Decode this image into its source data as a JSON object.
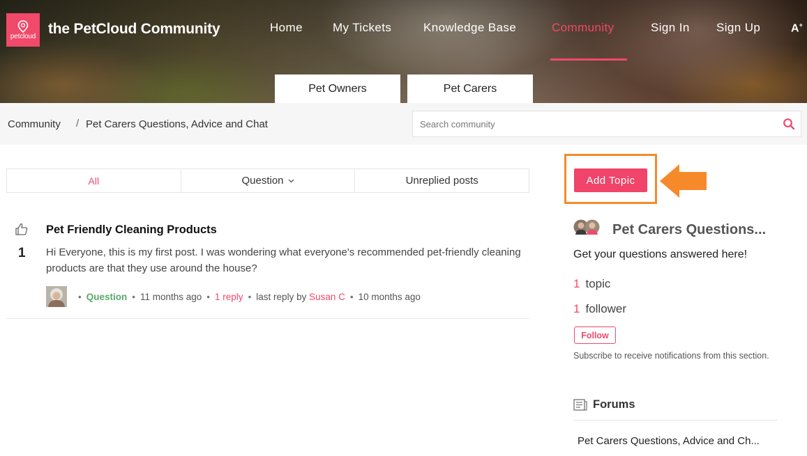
{
  "header": {
    "logo_text": "petcloud",
    "site_title": "the PetCloud Community",
    "nav": [
      {
        "label": "Home"
      },
      {
        "label": "My Tickets"
      },
      {
        "label": "Knowledge Base"
      },
      {
        "label": "Community",
        "active": true
      },
      {
        "label": "Sign In"
      },
      {
        "label": "Sign Up"
      }
    ],
    "accessibility_icon": "font-size-icon",
    "accessibility_text": "A"
  },
  "segment_tabs": [
    "Pet Owners",
    "Pet Carers"
  ],
  "breadcrumb": {
    "items": [
      "Community",
      "Pet Carers Questions, Advice and Chat"
    ],
    "separator": "/"
  },
  "search": {
    "placeholder": "Search community",
    "value": ""
  },
  "filters": {
    "items": [
      "All",
      "Question",
      "Unreplied posts"
    ],
    "active": "All"
  },
  "topic": {
    "votes": "1",
    "title": "Pet Friendly Cleaning Products",
    "body": "Hi Everyone, this is my first post. I was wondering what everyone's recommended pet-friendly cleaning products are that they use around the house?",
    "meta": {
      "dot": "•",
      "type": "Question",
      "posted": "11 months ago",
      "replies": "1 reply",
      "last_reply_prefix": "last reply by",
      "last_reply_user": "Susan C",
      "last_reply_time": "10 months ago"
    }
  },
  "sidebar": {
    "add_topic_label": "Add Topic",
    "forum_title": "Pet Carers Questions...",
    "forum_description": "Get your questions answered here!",
    "stats": [
      {
        "count": "1",
        "label": "topic"
      },
      {
        "count": "1",
        "label": "follower"
      }
    ],
    "follow_label": "Follow",
    "subscribe_note": "Subscribe to receive notifications from this section.",
    "forums_heading": "Forums",
    "forum_links": [
      "Pet Carers Questions, Advice and Ch..."
    ]
  },
  "colors": {
    "brand": "#f0496a",
    "annotation": "#f68a2b",
    "tag_green": "#5aa86b"
  }
}
